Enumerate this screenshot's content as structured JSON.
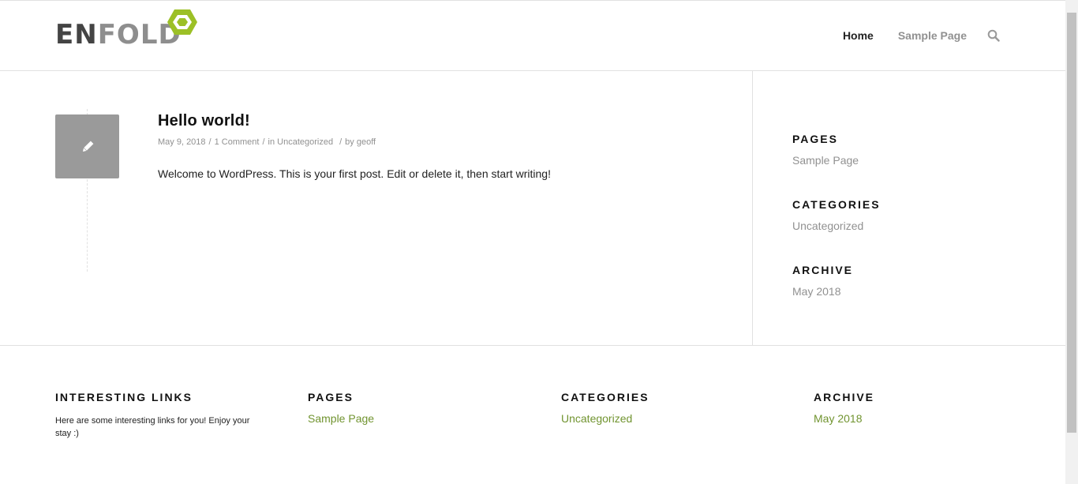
{
  "header": {
    "logo": {
      "part1": "EN",
      "part2": "FOLD",
      "accent_color": "#9cc026"
    },
    "nav": [
      {
        "label": "Home",
        "active": true
      },
      {
        "label": "Sample Page",
        "active": false
      }
    ],
    "search_icon": "search-icon"
  },
  "post": {
    "icon": "pencil-icon",
    "title": "Hello world!",
    "date": "May 9, 2018",
    "comments": "1 Comment",
    "in_prefix": "in",
    "category": "Uncategorized",
    "by_prefix": "by",
    "author": "geoff",
    "content": "Welcome to WordPress. This is your first post. Edit or delete it, then start writing!"
  },
  "sidebar": {
    "pages": {
      "title": "PAGES",
      "links": [
        "Sample Page"
      ]
    },
    "categories": {
      "title": "CATEGORIES",
      "links": [
        "Uncategorized"
      ]
    },
    "archive": {
      "title": "ARCHIVE",
      "links": [
        "May 2018"
      ]
    }
  },
  "footer": {
    "interesting": {
      "title": "INTERESTING LINKS",
      "text": "Here are some interesting links for you! Enjoy your stay :)"
    },
    "pages": {
      "title": "PAGES",
      "links": [
        "Sample Page"
      ]
    },
    "categories": {
      "title": "CATEGORIES",
      "links": [
        "Uncategorized"
      ]
    },
    "archive": {
      "title": "ARCHIVE",
      "links": [
        "May 2018"
      ]
    },
    "link_color": "#719430"
  }
}
